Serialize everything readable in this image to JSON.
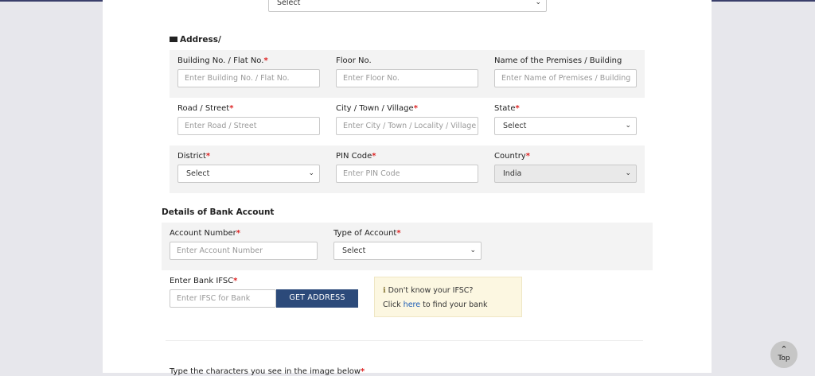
{
  "top_select": {
    "value": "Select"
  },
  "address": {
    "title": "Address/",
    "building_no": {
      "label": "Building No. / Flat No.",
      "placeholder": "Enter Building No. / Flat No."
    },
    "floor_no": {
      "label": "Floor No.",
      "placeholder": "Enter Floor No."
    },
    "premises": {
      "label": "Name of the Premises / Building",
      "placeholder": "Enter Name of Premises / Building"
    },
    "road": {
      "label": "Road / Street",
      "placeholder": "Enter Road / Street"
    },
    "city": {
      "label": "City / Town / Village",
      "placeholder": "Enter City / Town / Locality / Village"
    },
    "state": {
      "label": "State",
      "value": "Select"
    },
    "district": {
      "label": "District",
      "value": "Select"
    },
    "pin": {
      "label": "PIN Code",
      "placeholder": "Enter PIN Code"
    },
    "country": {
      "label": "Country",
      "value": "India"
    }
  },
  "bank": {
    "title": "Details of Bank Account",
    "account_number": {
      "label": "Account Number",
      "placeholder": "Enter Account Number"
    },
    "account_type": {
      "label": "Type of Account",
      "value": "Select"
    },
    "ifsc": {
      "label": "Enter Bank IFSC",
      "placeholder": "Enter IFSC for Bank"
    },
    "get_address_label": "GET ADDRESS",
    "help": {
      "line1": "Don't know your IFSC?",
      "click": "Click",
      "here": "here",
      "rest": "to find your bank"
    }
  },
  "captcha_label": "Type the characters you see in the image below",
  "required_mark": "*",
  "top_button_label": "Top",
  "colors": {
    "accent": "#2c4a7a",
    "required": "#dd2222",
    "info_bg": "#fcf7e1"
  }
}
